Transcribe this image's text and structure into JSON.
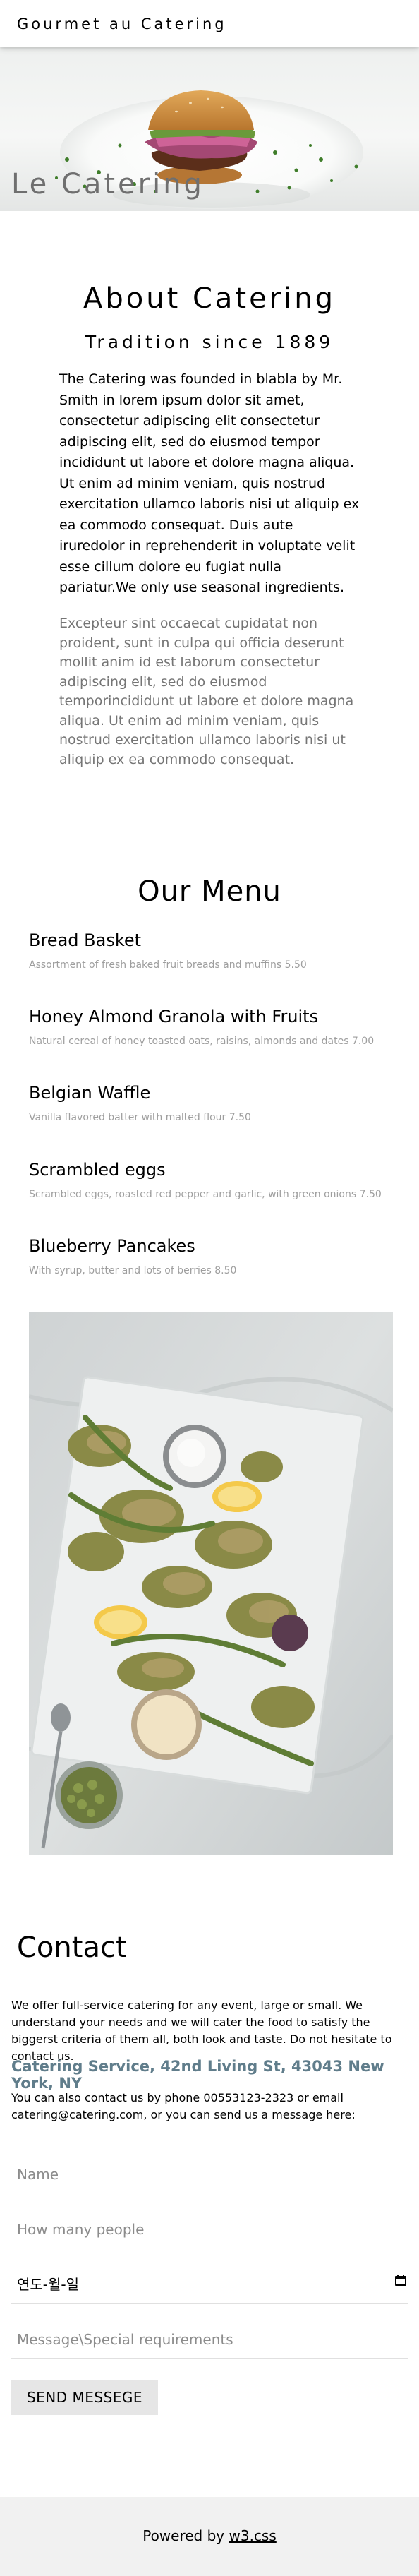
{
  "nav": {
    "brand": "Gourmet au Catering"
  },
  "hero": {
    "title": "Le Catering"
  },
  "about": {
    "heading": "About Catering",
    "subheading": "Tradition since 1889",
    "paragraph1": "The Catering was founded in blabla by Mr. Smith in lorem ipsum dolor sit amet, consectetur adipiscing elit consectetur adipiscing elit, sed do eiusmod tempor incididunt ut labore et dolore magna aliqua. Ut enim ad minim veniam, quis nostrud exercitation ullamco laboris nisi ut aliquip ex ea commodo consequat. Duis aute iruredolor in reprehenderit in voluptate velit esse cillum dolore eu fugiat nulla pariatur.We only use seasonal ingredients.",
    "paragraph2": "Excepteur sint occaecat cupidatat non proident, sunt in culpa qui officia deserunt mollit anim id est laborum consectetur adipiscing elit, sed do eiusmod temporincididunt ut labore et dolore magna aliqua. Ut enim ad minim veniam, quis nostrud exercitation ullamco laboris nisi ut aliquip ex ea commodo consequat."
  },
  "menu": {
    "heading": "Our Menu",
    "items": [
      {
        "name": "Bread Basket",
        "description": "Assortment of fresh baked fruit breads and muffins 5.50"
      },
      {
        "name": "Honey Almond Granola with Fruits",
        "description": "Natural cereal of honey toasted oats, raisins, almonds and dates 7.00"
      },
      {
        "name": "Belgian Waffle",
        "description": "Vanilla flavored batter with malted flour 7.50"
      },
      {
        "name": "Scrambled eggs",
        "description": "Scrambled eggs, roasted red pepper and garlic, with green onions 7.50"
      },
      {
        "name": "Blueberry Pancakes",
        "description": "With syrup, butter and lots of berries 8.50"
      }
    ]
  },
  "contact": {
    "heading": "Contact",
    "intro": "We offer full-service catering for any event, large or small. We understand your needs and we will cater the food to satisfy the biggerst criteria of them all, both look and taste. Do not hesitate to contact us.",
    "address": "Catering Service, 42nd Living St, 43043 New York, NY",
    "alt_contact": "You can also contact us by phone 00553123-2323 or email catering@catering.com, or you can send us a message here:",
    "name_placeholder": "Name",
    "people_placeholder": "How many people",
    "date_value": "연도-월-일",
    "message_placeholder": "Message\\Special requirements",
    "send_label": "SEND MESSEGE"
  },
  "footer": {
    "powered_by": "Powered by",
    "link_text": "w3.css"
  },
  "colors": {
    "address": "#607d8b",
    "muted": "#757575",
    "footer_bg": "#f1f1f1",
    "button_bg": "#e6e6e6"
  }
}
